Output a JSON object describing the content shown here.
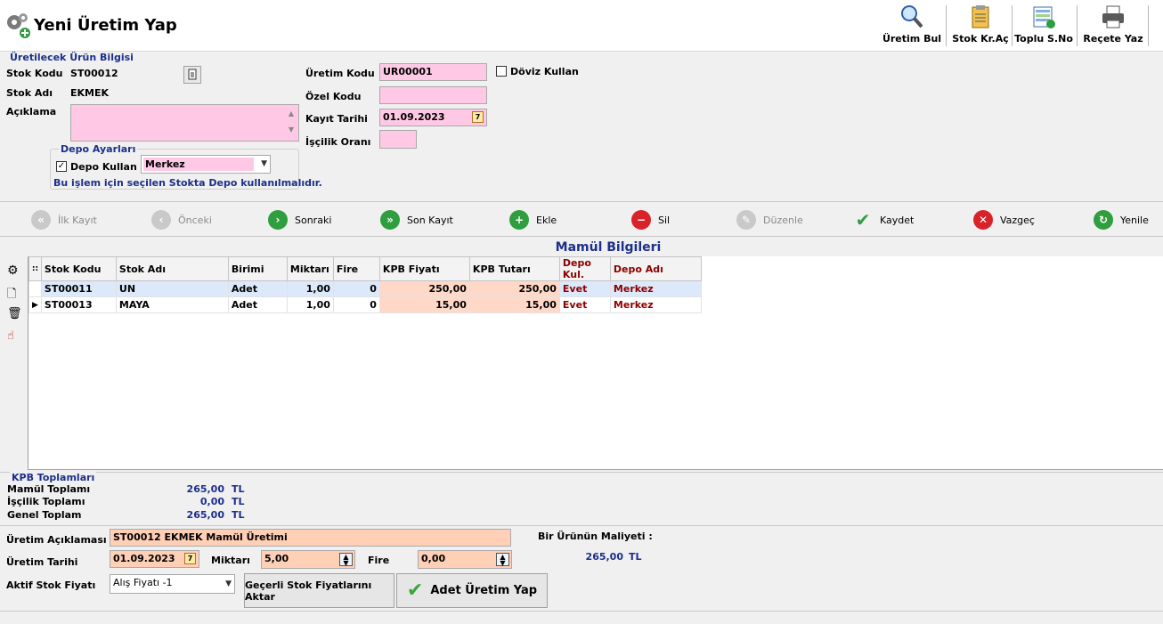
{
  "header": {
    "title": "Yeni Üretim Yap",
    "tools": [
      {
        "label": "Üretim Bul",
        "icon": "magnifier-icon"
      },
      {
        "label": "Stok Kr.Aç",
        "icon": "clipboard-icon"
      },
      {
        "label": "Toplu S.No",
        "icon": "document-list-icon"
      },
      {
        "label": "Reçete Yaz",
        "icon": "printer-icon"
      }
    ]
  },
  "product_info": {
    "group_title": "Üretilecek Ürün Bilgisi",
    "stok_kodu_label": "Stok Kodu",
    "stok_kodu": "ST00012",
    "stok_adi_label": "Stok Adı",
    "stok_adi": "EKMEK",
    "aciklama_label": "Açıklama",
    "aciklama": "",
    "uretim_kodu_label": "Üretim Kodu",
    "uretim_kodu": "UR00001",
    "ozel_kodu_label": "Özel Kodu",
    "ozel_kodu": "",
    "kayit_tarihi_label": "Kayıt Tarihi",
    "kayit_tarihi": "01.09.2023",
    "iscilik_orani_label": "İşçilik Oranı",
    "iscilik_orani": "",
    "doviz_label": "Döviz Kullan",
    "doviz_checked": false
  },
  "depo": {
    "group_title": "Depo Ayarları",
    "depo_kullan_label": "Depo Kullan",
    "depo_kullan_checked": true,
    "depo_value": "Merkez",
    "note": "Bu işlem için seçilen Stokta Depo kullanılmalıdır."
  },
  "nav": [
    {
      "label": "İlk Kayıt",
      "enabled": false
    },
    {
      "label": "Önceki",
      "enabled": false
    },
    {
      "label": "Sonraki",
      "enabled": true
    },
    {
      "label": "Son Kayıt",
      "enabled": true
    },
    {
      "label": "Ekle",
      "enabled": true
    },
    {
      "label": "Sil",
      "enabled": true
    },
    {
      "label": "Düzenle",
      "enabled": false
    },
    {
      "label": "Kaydet",
      "enabled": true
    },
    {
      "label": "Vazgeç",
      "enabled": true
    },
    {
      "label": "Yenile",
      "enabled": true
    }
  ],
  "grid": {
    "title": "Mamül Bilgileri",
    "columns": [
      "Stok Kodu",
      "Stok Adı",
      "Birimi",
      "Miktarı",
      "Fire",
      "KPB Fiyatı",
      "KPB Tutarı",
      "Depo Kul.",
      "Depo Adı"
    ],
    "rows": [
      {
        "stok_kodu": "ST00011",
        "stok_adi": "UN",
        "birimi": "Adet",
        "miktari": "1,00",
        "fire": "0",
        "kpb_fiyati": "250,00",
        "kpb_tutari": "250,00",
        "depo_kul": "Evet",
        "depo_adi": "Merkez"
      },
      {
        "stok_kodu": "ST00013",
        "stok_adi": "MAYA",
        "birimi": "Adet",
        "miktari": "1,00",
        "fire": "0",
        "kpb_fiyati": "15,00",
        "kpb_tutari": "15,00",
        "depo_kul": "Evet",
        "depo_adi": "Merkez"
      }
    ]
  },
  "totals": {
    "group_title": "KPB Toplamları",
    "mamul_label": "Mamül Toplamı",
    "mamul": "265,00",
    "iscilik_label": "İşçilik Toplamı",
    "iscilik": "0,00",
    "genel_label": "Genel Toplam",
    "genel": "265,00",
    "currency": "TL"
  },
  "production": {
    "aciklama_label": "Üretim Açıklaması",
    "aciklama": "ST00012 EKMEK Mamül Üretimi",
    "tarih_label": "Üretim Tarihi",
    "tarih": "01.09.2023",
    "miktar_label": "Miktarı",
    "miktar": "5,00",
    "fire_label": "Fire",
    "fire": "0,00",
    "fiyat_label": "Aktif Stok Fiyatı",
    "fiyat": "Alış Fiyatı -1",
    "maliyet_label": "Bir Ürünün Maliyeti :",
    "maliyet": "265,00",
    "maliyet_currency": "TL",
    "aktar_button": "Geçerli Stok Fiyatlarını Aktar",
    "uret_button": "Adet Üretim Yap"
  }
}
